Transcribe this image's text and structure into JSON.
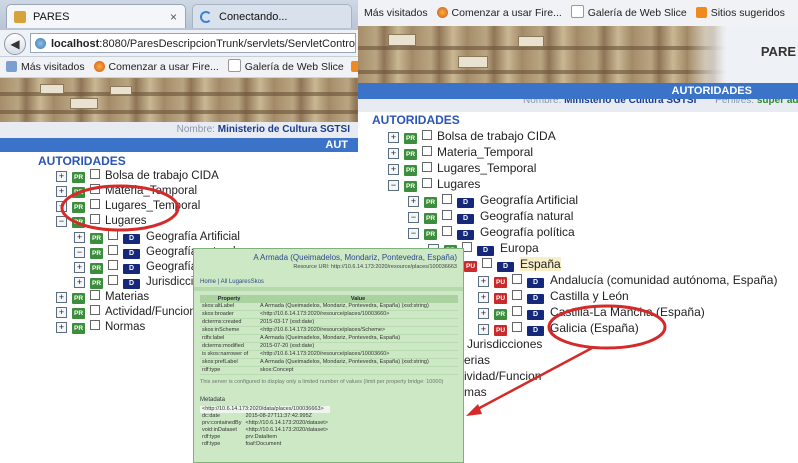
{
  "left_browser": {
    "tab_active": "PARES",
    "tab_close": "×",
    "tab_loading": "Conectando...",
    "url_host": "localhost",
    "url_rest": ":8080/ParesDescripcionTrunk/servlets/ServletController#id",
    "bookmarks": [
      "Más visitados",
      "Comenzar a usar Fire...",
      "Galería de Web Slice"
    ],
    "user_label": "Nombre:",
    "user_value": "Ministerio de Cultura SGTSI",
    "bluebar_text": "AUT",
    "heading": "AUTORIDADES",
    "tree": [
      {
        "label": "Bolsa de trabajo CIDA",
        "toggle": "+"
      },
      {
        "label": "Materia_Temporal",
        "toggle": "+"
      },
      {
        "label": "Lugares_Temporal",
        "toggle": "+"
      },
      {
        "label": "Lugares",
        "toggle": "−"
      },
      {
        "label": "Geografía Artificial",
        "toggle": "+"
      },
      {
        "label": "Geografía natural",
        "toggle": "−"
      },
      {
        "label": "Geografía política",
        "toggle": "+"
      },
      {
        "label": "Jurisdicciones",
        "toggle": "+"
      },
      {
        "label": "Materias",
        "toggle": "+"
      },
      {
        "label": "Actividad/Funcion",
        "toggle": "+"
      },
      {
        "label": "Normas",
        "toggle": "+"
      }
    ]
  },
  "right_browser": {
    "bookmarks": [
      "Más visitados",
      "Comenzar a usar Fire...",
      "Galería de Web Slice",
      "Sitios sugeridos"
    ],
    "site_title": "PARE",
    "user_label": "Nombre:",
    "user_value": "Ministerio de Cultura SGTSI",
    "profile_label": "Perfil/es:",
    "profile_value": "super adm",
    "bluebar_text": "AUTORIDADES",
    "heading": "AUTORIDADES",
    "tree": [
      {
        "label": "Bolsa de trabajo CIDA"
      },
      {
        "label": "Materia_Temporal"
      },
      {
        "label": "Lugares_Temporal"
      },
      {
        "label": "Lugares"
      },
      {
        "label": "Geografía Artificial"
      },
      {
        "label": "Geografía natural"
      },
      {
        "label": "Geografía política"
      },
      {
        "label": "Europa"
      },
      {
        "label": "España"
      },
      {
        "label": "Andalucía (comunidad autónoma, España)"
      },
      {
        "label": "Castilla y León"
      },
      {
        "label": "Castilla-La Mancha (España)"
      },
      {
        "label": "Galicia (España)"
      },
      {
        "label": "Jurisdicciones"
      },
      {
        "label": "erias"
      },
      {
        "label": "ividad/Funcion"
      },
      {
        "label": "mas"
      }
    ]
  },
  "badges": {
    "pr": "PR",
    "pu": "PU",
    "d": "D"
  },
  "overlay": {
    "title": "A Armada (Queimadelos, Mondariz, Pontevedra, España)",
    "subtitle": "Resource URI: http://10.6.14.173:2020/resource/places/100036663",
    "breadcrumb": "Home | All LugaresSkos",
    "col_property": "Property",
    "col_value": "Value",
    "rows": [
      [
        "skos:altLabel",
        "A Armada (Queimadelos, Mondariz, Pontevedra, España) (xsd:string)"
      ],
      [
        "skos:broader",
        "<http://10.6.14.173:2020/resource/places/10003660>"
      ],
      [
        "dcterms:created",
        "2015-03-17 (xsd:date)"
      ],
      [
        "skos:inScheme",
        "<http://10.6.14.173:2020/resource/places/Scheme>"
      ],
      [
        "rdfs:label",
        "A Armada (Queimadelos, Mondariz, Pontevedra, España)"
      ],
      [
        "dcterms:modified",
        "2015-07-20 (xsd:date)"
      ],
      [
        "is skos:narrower of",
        "<http://10.6.14.173:2020/resource/places/10003660>"
      ],
      [
        "skos:prefLabel",
        "A Armada (Queimadelos, Mondariz, Pontevedra, España) (xsd:string)"
      ],
      [
        "rdf:type",
        "skos:Concept"
      ]
    ],
    "note": "This server is configured to display only a limited number of values (limit per property bridge: 10000)",
    "metadata_label": "Metadata",
    "meta_rows": [
      [
        "<http://10.6.14.173:2020/data/places/100036663>",
        ""
      ],
      [
        "dc:date",
        "2015-08-27T11:37:42.995Z"
      ],
      [
        "prv:containedBy",
        "<http://10.6.14.173:2020/dataset>"
      ],
      [
        "void:inDataset",
        "<http://10.6.14.173:2020/dataset>"
      ],
      [
        "rdf:type",
        "prv:DataItem"
      ],
      [
        "rdf:type",
        "foaf:Document"
      ]
    ]
  },
  "colors": {
    "accent_blue": "#3a73c8",
    "annotation_red": "#d42a2a",
    "overlay_green": "#cde8c5"
  }
}
